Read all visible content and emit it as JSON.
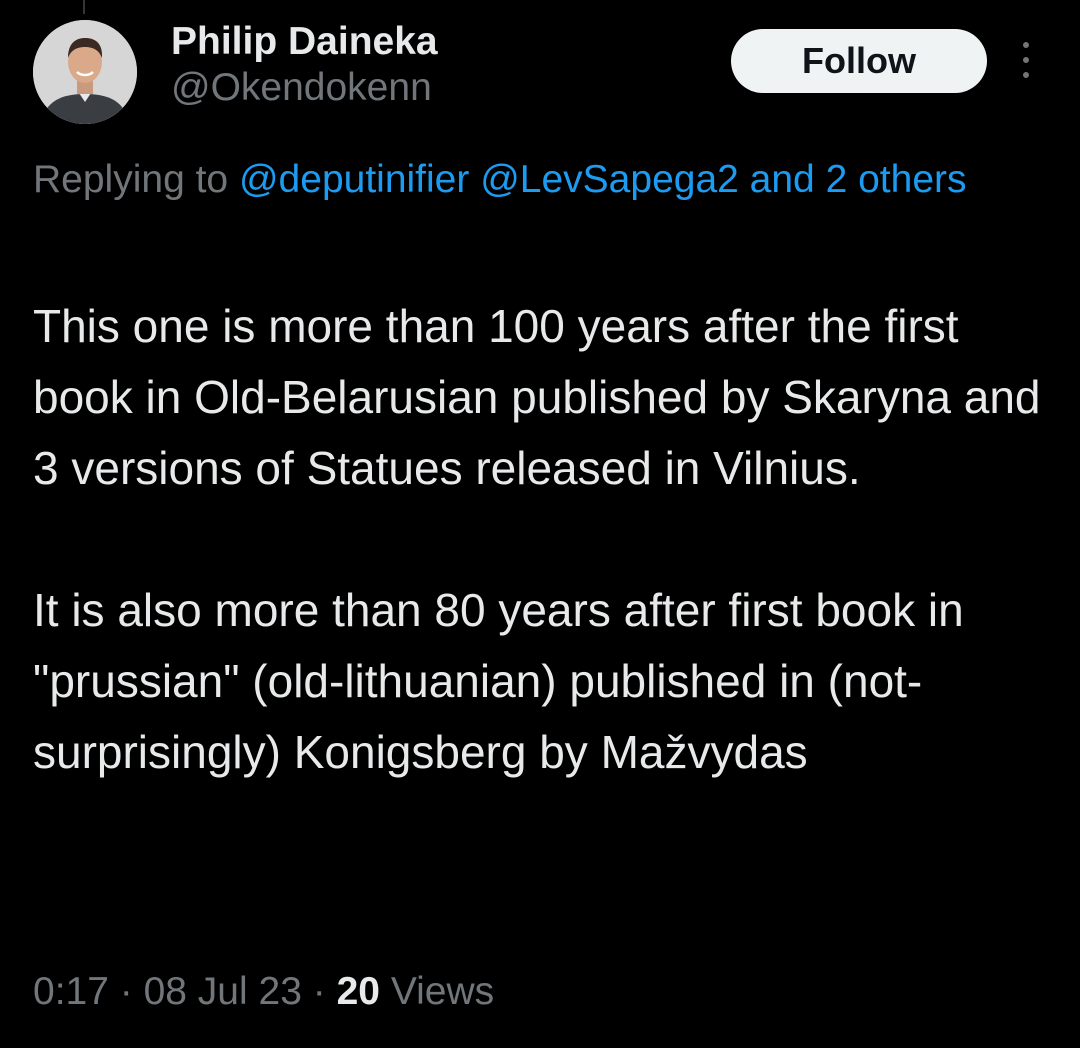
{
  "tweet": {
    "author": {
      "display_name": "Philip Daineka",
      "handle": "@Okendokenn"
    },
    "follow_label": "Follow",
    "more_icon": "more-vertical-icon",
    "reply": {
      "prefix": "Replying to",
      "mentions": [
        "@deputinifier",
        "@LevSapega2"
      ],
      "others_label": "and 2 others"
    },
    "body": [
      "This one is more than 100 years after the first book in Old-Belarusian published by Skaryna and 3 versions of Statues released in Vilnius.",
      "It is also more than 80 years after first book in \"prussian\" (old-lithuanian) published in (not-surprisingly) Konigsberg by Mažvydas"
    ],
    "meta": {
      "time": "0:17",
      "separator": "·",
      "date": "08 Jul 23",
      "views_count": "20",
      "views_label": "Views"
    }
  },
  "colors": {
    "background": "#000000",
    "text_primary": "#e7e9ea",
    "text_secondary": "#71767b",
    "link": "#1d9bf0",
    "follow_button_bg": "#eff3f4",
    "follow_button_text": "#0f1419"
  }
}
